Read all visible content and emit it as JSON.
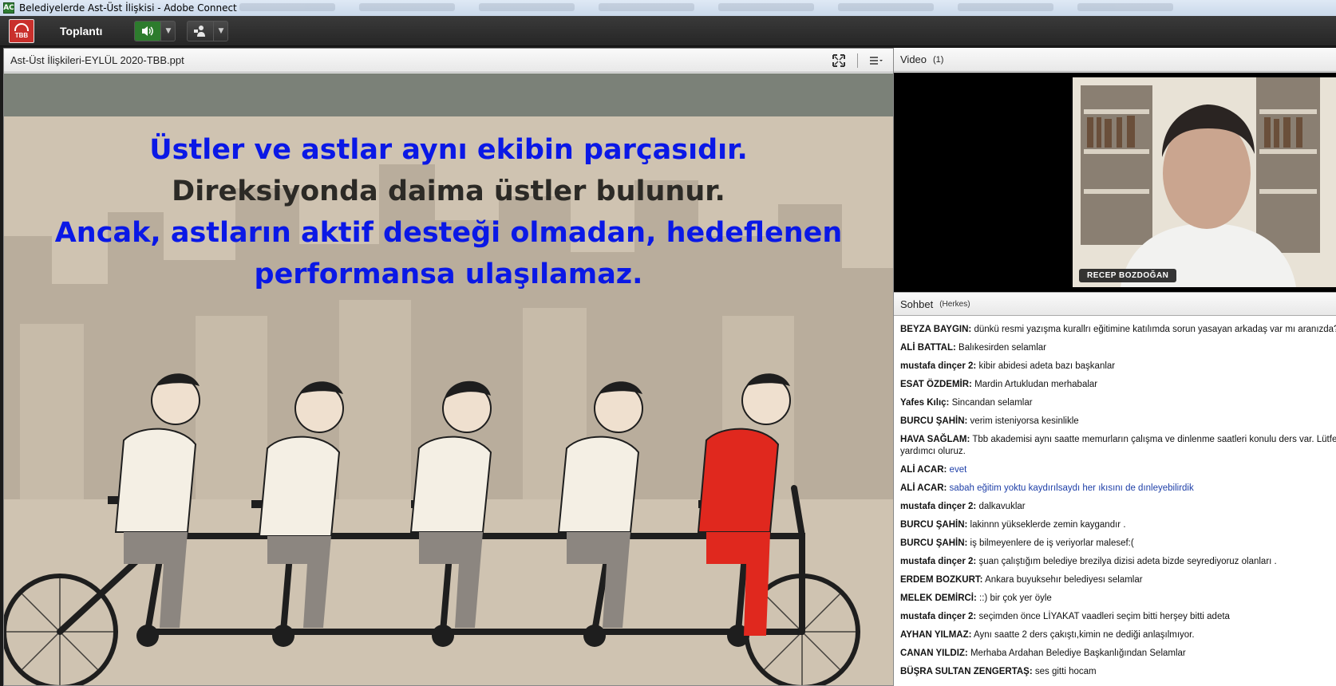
{
  "window": {
    "title": "Belediyelerde Ast-Üst İlişkisi - Adobe Connect",
    "app_icon": "adobe-connect-icon"
  },
  "menubar": {
    "logo": "TBB",
    "meeting_menu": "Toplantı"
  },
  "share_pod": {
    "title": "Ast-Üst İlişkileri-EYLÜL 2020-TBB.ppt",
    "slide": {
      "line1": "Üstler ve astlar aynı ekibin parçasıdır.",
      "line2": "Direksiyonda daima üstler bulunur.",
      "line3": "Ancak, astların aktif desteği olmadan, hedeflenen",
      "line4": "performansa ulaşılamaz."
    }
  },
  "video_pod": {
    "title": "Video",
    "count": "(1)",
    "participant": "RECEP BOZDOĞAN"
  },
  "chat_pod": {
    "title": "Sohbet",
    "audience": "(Herkes)",
    "messages": [
      {
        "who": "BEYZA BAYGIN:",
        "msg": "dünkü resmi yazışma kurallrı eğitimine katılımda sorun yasayan arkadaş var mı aranızda?"
      },
      {
        "who": "ALİ BATTAL:",
        "msg": "Balıkesirden selamlar"
      },
      {
        "who": "mustafa dinçer 2:",
        "msg": "kibir abidesi adeta bazı başkanlar"
      },
      {
        "who": "ESAT ÖZDEMİR:",
        "msg": "Mardin Artukludan merhabalar"
      },
      {
        "who": "Yafes Kılıç:",
        "msg": "Sincandan selamlar"
      },
      {
        "who": "BURCU ŞAHİN:",
        "msg": "verim isteniyorsa kesinlikle"
      },
      {
        "who": "HAVA SAĞLAM:",
        "msg": "Tbb akademisi aynı saatte memurların çalışma ve dinlenme saatleri konulu ders var. Lütfen yardımcı oluruz."
      },
      {
        "who": "ALİ ACAR:",
        "msg": "evet"
      },
      {
        "who": "ALİ ACAR:",
        "msg": "sabah eğitim yoktu kaydırılsaydı her ıkısını de dınleyebilirdik"
      },
      {
        "who": "mustafa dinçer 2:",
        "msg": "dalkavuklar"
      },
      {
        "who": "BURCU ŞAHİN:",
        "msg": "lakinnn yükseklerde zemin kaygandır ."
      },
      {
        "who": "BURCU ŞAHİN:",
        "msg": "iş bilmeyenlere de iş veriyorlar malesef:("
      },
      {
        "who": "mustafa dinçer 2:",
        "msg": "şuan çalıştığım belediye brezilya dizisi adeta bizde seyrediyoruz olanları ."
      },
      {
        "who": "ERDEM BOZKURT:",
        "msg": "Ankara buyuksehır belediyesı selamlar"
      },
      {
        "who": "MELEK DEMİRCİ:",
        "msg": "::) bir çok yer öyle"
      },
      {
        "who": "mustafa dinçer 2:",
        "msg": "seçimden önce LİYAKAT vaadleri seçim bitti herşey bitti adeta"
      },
      {
        "who": "AYHAN YILMAZ:",
        "msg": "Aynı saatte 2 ders çakıştı,kimin ne dediği anlaşılmıyor."
      },
      {
        "who": "CANAN YILDIZ:",
        "msg": "Merhaba Ardahan Belediye Başkanlığından Selamlar"
      },
      {
        "who": "BÜŞRA SULTAN ZENGERTAŞ:",
        "msg": "ses gitti hocam"
      }
    ]
  },
  "colors": {
    "slide_blue": "#0a18e6",
    "slide_dark": "#2c2a26",
    "speaker_active": "#2d7c2d",
    "red_rider": "#e0281e"
  },
  "icons": [
    "speaker-icon",
    "webcam-person-icon",
    "fullscreen-icon",
    "pod-menu-icon",
    "chevron-down-icon"
  ]
}
